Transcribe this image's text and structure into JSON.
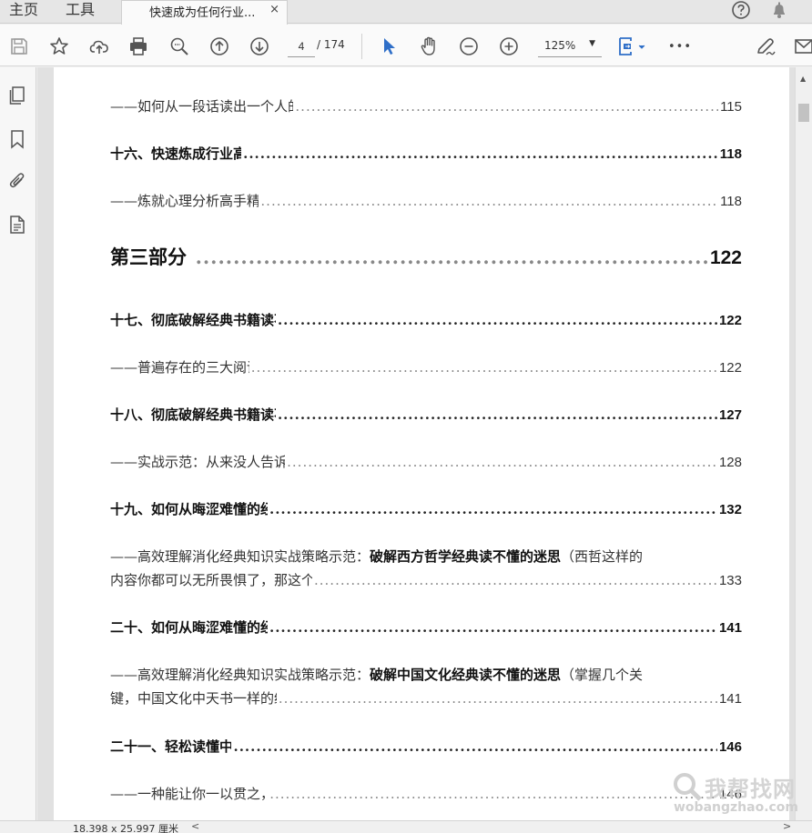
{
  "tabs": {
    "home": "主页",
    "tools": "工具",
    "document": "快速成为任何行业...",
    "close": "×"
  },
  "toolbar": {
    "current_page": "4",
    "total_pages": "/ 174",
    "zoom": "125%",
    "zoom_caret": "▼",
    "more": "•••",
    "icons": [
      "save-icon",
      "bookmark-star-icon",
      "upload-cloud-icon",
      "print-icon",
      "zoom-search-icon",
      "page-up-icon",
      "page-down-icon",
      "select-arrow-icon",
      "hand-icon",
      "zoom-out-icon",
      "zoom-in-icon",
      "fit-page-icon",
      "more-icon",
      "sign-icon",
      "mail-icon"
    ]
  },
  "sidebar": {
    "icons": [
      "pages-icon",
      "bookmarks-icon",
      "attachments-icon",
      "document-properties-icon"
    ],
    "collapse": "◀"
  },
  "toc": [
    {
      "kind": "sub",
      "title": "——如何从一段话读出一个人的个性特征、家庭背景、职业角色等信息？",
      "page": "115"
    },
    {
      "kind": "heading",
      "title": "十六、快速炼成行业高手之心理学实战举例（七）",
      "page": "118"
    },
    {
      "kind": "sub",
      "title": "——炼就心理分析高手精准分析，铁口直断的关键步骤",
      "page": "118"
    },
    {
      "kind": "part",
      "title": "第三部分 高效理解力训练篇",
      "page": "122"
    },
    {
      "kind": "heading",
      "title": "十七、彻底破解经典书籍读不懂、速度慢、读完忘的阅读纠结（一）",
      "page": "122"
    },
    {
      "kind": "sub",
      "title": "——普遍存在的三大阅读误区“毒”倒多少英雄好汉",
      "page": "122"
    },
    {
      "kind": "heading",
      "title": "十八、彻底破解经典书籍读不懂、速度慢、读完忘的阅读纠结（二）",
      "page": "127"
    },
    {
      "kind": "sub",
      "title": "——实战示范：从来没人告诉你《六顶思考帽》真正的价值在这里！",
      "page": "128"
    },
    {
      "kind": "heading",
      "title": "十九、如何从晦涩难懂的经典中嚼出恍然大悟的味道来？（上）",
      "page": "132"
    },
    {
      "kind": "multi",
      "prefix": "——高效理解消化经典知识实战策略示范：",
      "bold": "破解西方哲学经典读不懂的迷思",
      "suffix": "（西哲这样的",
      "line2": "内容你都可以无所畏惧了，那这个世界上也就没有什么内容还可以让你有所畏惧了）",
      "page": "133"
    },
    {
      "kind": "heading",
      "title": "二十、如何从晦涩难懂的经典中嚼出恍然大悟的味道来？（下）",
      "page": "141"
    },
    {
      "kind": "multi",
      "prefix": "——高效理解消化经典知识实战策略示范：",
      "bold": "破解中国文化经典读不懂的迷思",
      "suffix": "（掌握几个关",
      "line2": "键，中国文化中天书一样的经典，其实比西哲好懂，好用多了）",
      "page": "141"
    },
    {
      "kind": "heading",
      "title": "二十一、轻松读懂中国文化经典的揣摩术之一",
      "page": "146"
    },
    {
      "kind": "sub",
      "title": "——一种能让你一以贯之，一通百通的中国文化底层思维？",
      "page": "146"
    }
  ],
  "status": {
    "dimensions": "18.398 x 25.997 厘米",
    "scroll_left": "<",
    "scroll_right": ">"
  },
  "watermark": {
    "cn": "我帮找网",
    "url": "wobangzhao.com"
  }
}
